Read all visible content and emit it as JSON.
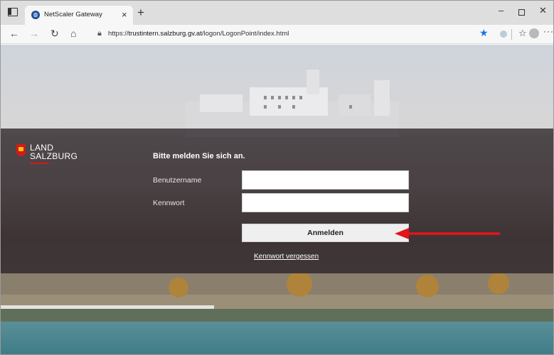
{
  "browser": {
    "tab_title": "NetScaler Gateway",
    "tab_close": "×",
    "new_tab": "+",
    "url_prefix": "https://",
    "url_host": "trustintern.salzburg.gv.at",
    "url_path": "/logon/LogonPoint/index.html",
    "window_controls": {
      "minimize": "–",
      "close": "✕"
    },
    "icons": [
      "tab-actions-icon",
      "back-icon",
      "forward-icon",
      "reload-icon",
      "home-icon",
      "lock-icon",
      "star-icon",
      "favorites-icon",
      "profile-icon",
      "more-icon"
    ]
  },
  "logo": {
    "line1": "LAND",
    "line2": "SALZBURG"
  },
  "login": {
    "title": "Bitte melden Sie sich an.",
    "username_label": "Benutzername",
    "password_label": "Kennwort",
    "username_value": "",
    "password_value": "",
    "submit_label": "Anmelden",
    "forgot_label": "Kennwort vergessen"
  },
  "colors": {
    "overlay": "#342c30",
    "annotation_arrow": "#e3141c",
    "brand_red": "#d31919"
  }
}
